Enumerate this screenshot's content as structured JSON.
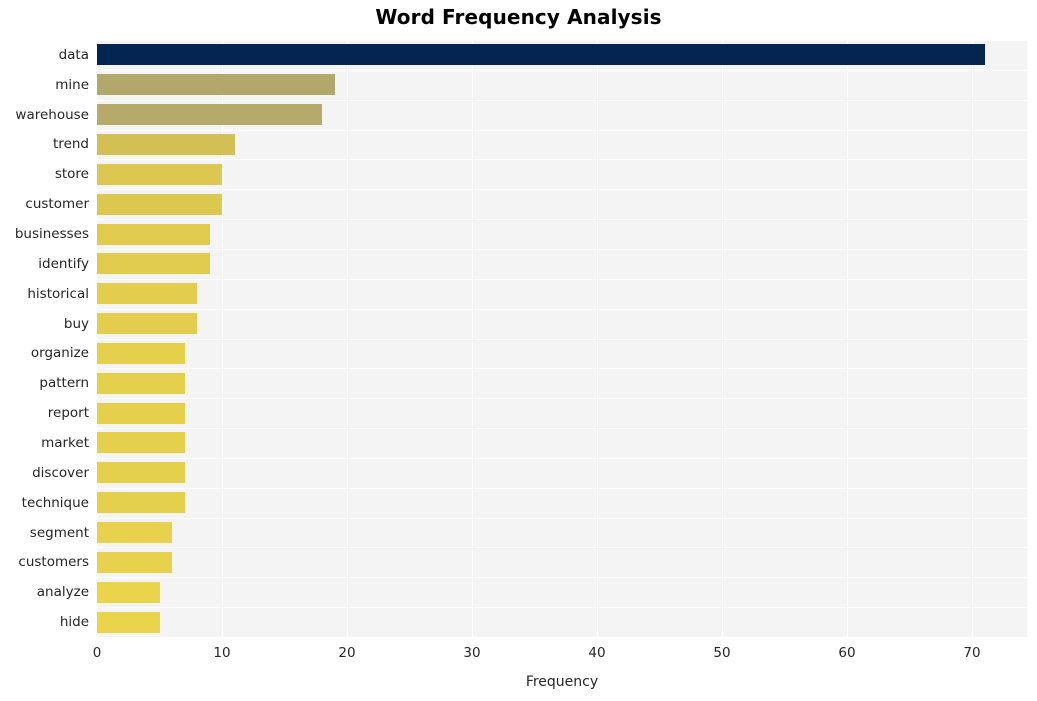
{
  "chart_data": {
    "type": "bar",
    "orientation": "horizontal",
    "title": "Word Frequency Analysis",
    "xlabel": "Frequency",
    "ylabel": "",
    "categories": [
      "data",
      "mine",
      "warehouse",
      "trend",
      "store",
      "customer",
      "businesses",
      "identify",
      "historical",
      "buy",
      "organize",
      "pattern",
      "report",
      "market",
      "discover",
      "technique",
      "segment",
      "customers",
      "analyze",
      "hide"
    ],
    "values": [
      71,
      19,
      18,
      11,
      10,
      10,
      9,
      9,
      8,
      8,
      7,
      7,
      7,
      7,
      7,
      7,
      6,
      6,
      5,
      5
    ],
    "bar_colors": [
      "#04254f",
      "#b3a86b",
      "#b5aa6a",
      "#d2c055",
      "#dcc850",
      "#dcc850",
      "#e0cb4f",
      "#e0cb4f",
      "#e2cd4e",
      "#e2cd4e",
      "#e5d04d",
      "#e5d04d",
      "#e5d04d",
      "#e5d04d",
      "#e5d04d",
      "#e5d04d",
      "#e8d24d",
      "#e8d24d",
      "#e9d44c",
      "#e9d44c"
    ],
    "xticks": [
      "0",
      "10",
      "20",
      "30",
      "40",
      "50",
      "60",
      "70"
    ],
    "xtick_values": [
      0,
      10,
      20,
      30,
      40,
      50,
      60,
      70
    ],
    "xlim": [
      0,
      74.4
    ],
    "grid": true,
    "grid_color": "#ffffff",
    "plot_background": "#f4f4f4",
    "legend": null
  },
  "figure": {
    "background": "#ffffff",
    "title_color": "#000000",
    "tick_label_color": "#262626"
  }
}
